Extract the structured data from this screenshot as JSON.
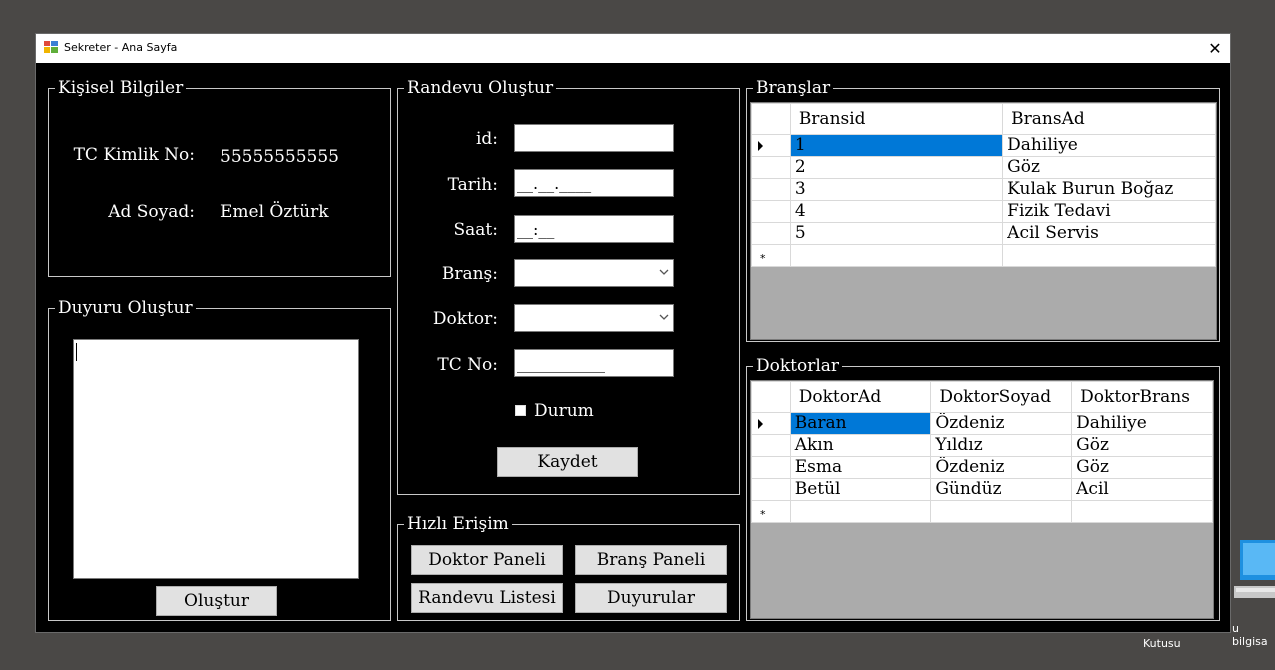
{
  "window": {
    "title": "Sekreter - Ana Sayfa",
    "close_glyph": "✕"
  },
  "desktop": {
    "label_line1": "u bilgisa",
    "label_line2": "Kutusu"
  },
  "kisisel": {
    "title": "Kişisel Bilgiler",
    "tc_label": "TC Kimlik No:",
    "tc_value": "55555555555",
    "ad_label": "Ad Soyad:",
    "ad_value": "Emel Öztürk"
  },
  "duyuru": {
    "title": "Duyuru Oluştur",
    "text": "",
    "button": "Oluştur"
  },
  "randevu": {
    "title": "Randevu Oluştur",
    "id_label": "id:",
    "id_value": "",
    "tarih_label": "Tarih:",
    "tarih_mask": "__.__.____",
    "saat_label": "Saat:",
    "saat_mask": "__:__",
    "brans_label": "Branş:",
    "brans_value": "",
    "doktor_label": "Doktor:",
    "doktor_value": "",
    "tc_label": "TC No:",
    "tc_mask": "___________",
    "durum_label": "Durum",
    "save_button": "Kaydet"
  },
  "hizli": {
    "title": "Hızlı Erişim",
    "buttons": [
      "Doktor Paneli",
      "Branş Paneli",
      "Randevu Listesi",
      "Duyurular"
    ]
  },
  "branslar": {
    "title": "Branşlar",
    "columns": [
      "Bransid",
      "BransAd"
    ],
    "rows": [
      [
        "1",
        "Dahiliye"
      ],
      [
        "2",
        "Göz"
      ],
      [
        "3",
        "Kulak Burun Boğaz"
      ],
      [
        "4",
        "Fizik Tedavi"
      ],
      [
        "5",
        "Acil Servis"
      ]
    ]
  },
  "doktorlar": {
    "title": "Doktorlar",
    "columns": [
      "DoktorAd",
      "DoktorSoyad",
      "DoktorBrans"
    ],
    "rows": [
      [
        "Baran",
        "Özdeniz",
        "Dahiliye"
      ],
      [
        "Akın",
        "Yıldız",
        "Göz"
      ],
      [
        "Esma",
        "Özdeniz",
        "Göz"
      ],
      [
        "Betül",
        "Gündüz",
        "Acil"
      ]
    ]
  },
  "colors": {
    "selection": "#0078d7",
    "background": "#000000",
    "grid_empty": "#ababab"
  }
}
